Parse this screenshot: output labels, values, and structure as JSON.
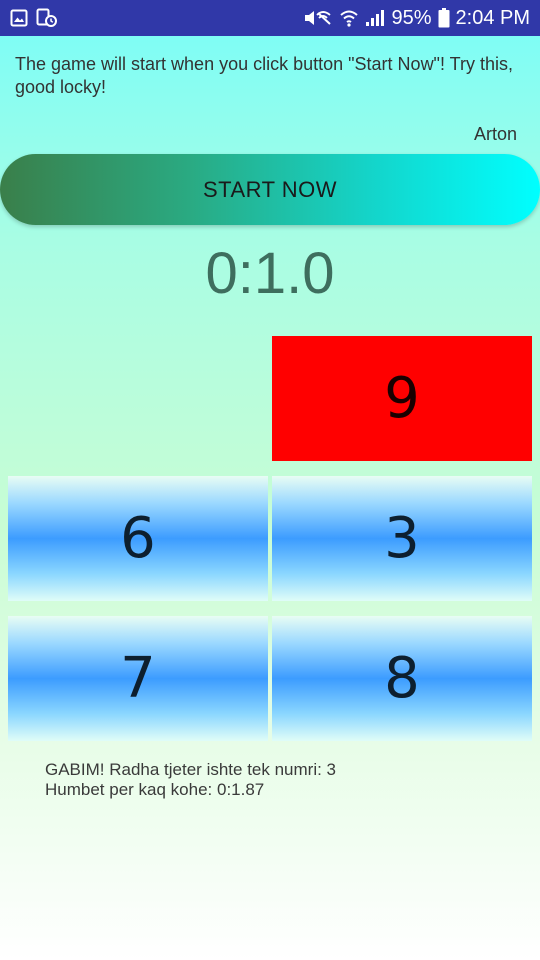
{
  "status_bar": {
    "battery_percent": "95%",
    "time": "2:04 PM",
    "left_icons": [
      "gallery-icon",
      "notification-image-icon"
    ],
    "right_icons": [
      "mute-icon",
      "wifi-icon",
      "signal-icon",
      "battery-icon"
    ]
  },
  "intro": {
    "text": "The game will start when you click button \"Start Now\"! Try this, good locky!"
  },
  "author": "Arton",
  "start_button": {
    "label": "START NOW",
    "gradient": [
      "#3a7f4a",
      "#00ffff"
    ]
  },
  "timer": "0:1.0",
  "grid": {
    "tiles": [
      {
        "label": "9",
        "color": "#ff0000",
        "style": "red"
      },
      {
        "label": "6",
        "style": "blue"
      },
      {
        "label": "3",
        "style": "blue"
      },
      {
        "label": "7",
        "style": "blue"
      },
      {
        "label": "8",
        "style": "blue"
      }
    ]
  },
  "feedback": {
    "line1": "GABIM! Radha tjeter ishte tek numri: 3",
    "line2": "Humbet per kaq kohe: 0:1.87"
  },
  "colors": {
    "status_bar": "#3038a8",
    "timer": "#3e6e5e",
    "tile_blue": "#3c9cff"
  }
}
